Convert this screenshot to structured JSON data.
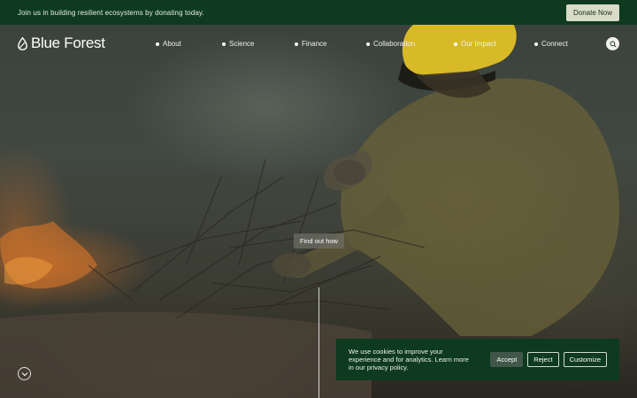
{
  "banner": {
    "text": "Join us in building resilient ecosystems by donating today.",
    "donate_label": "Donate Now"
  },
  "header": {
    "logo_text": "Blue Forest",
    "nav": [
      {
        "label": "About"
      },
      {
        "label": "Science"
      },
      {
        "label": "Finance"
      },
      {
        "label": "Collaboration"
      },
      {
        "label": "Our Impact"
      },
      {
        "label": "Connect"
      }
    ]
  },
  "hero": {
    "cta_label": "Find out how"
  },
  "cookie": {
    "text": "We use cookies to improve your experience and for analytics. Learn more in our privacy policy.",
    "accept_label": "Accept",
    "reject_label": "Reject",
    "customize_label": "Customize"
  },
  "colors": {
    "banner_bg": "#0e3a1f",
    "donate_bg": "#d9dcc9",
    "accept_bg": "#40574a",
    "helmet": "#d8b928"
  },
  "icons": {
    "logo": "leaf-icon",
    "search": "search-icon",
    "scroll": "chevron-down-icon"
  }
}
